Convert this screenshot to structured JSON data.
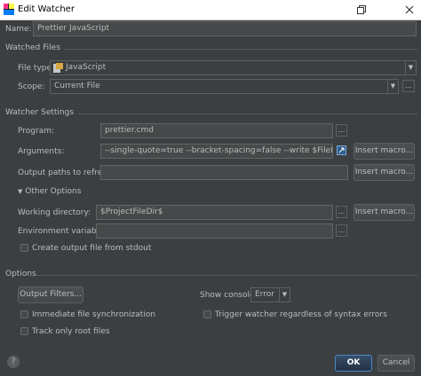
{
  "window": {
    "title": "Edit Watcher",
    "restore_icon": "restore-window-icon",
    "close_icon": "close-icon"
  },
  "name": {
    "label": "Name:",
    "value": "Prettier JavaScript"
  },
  "watched_files": {
    "section": "Watched Files",
    "file_type_label": "File type:",
    "file_type_value": "JavaScript",
    "scope_label": "Scope:",
    "scope_value": "Current File",
    "browse": "..."
  },
  "watcher_settings": {
    "section": "Watcher Settings",
    "program_label": "Program:",
    "program_value": "prettier.cmd",
    "arguments_label": "Arguments:",
    "arguments_value": "--single-quote=true --bracket-spacing=false --write $FilePath$",
    "output_paths_label": "Output paths to refresh:",
    "output_paths_value": "",
    "insert_macro": "Insert macro...",
    "browse": "...",
    "other_options": "Other Options",
    "working_dir_label": "Working directory:",
    "working_dir_value": "$ProjectFileDir$",
    "env_vars_label": "Environment variables:",
    "env_vars_value": "",
    "create_output_label": "Create output file from stdout"
  },
  "options": {
    "section": "Options",
    "output_filters": "Output Filters...",
    "show_console_label": "Show console:",
    "show_console_value": "Error",
    "immediate_sync": "Immediate file synchronization",
    "trigger_watcher": "Trigger watcher regardless of syntax errors",
    "track_root": "Track only root files"
  },
  "footer": {
    "help": "?",
    "ok": "OK",
    "cancel": "Cancel"
  }
}
